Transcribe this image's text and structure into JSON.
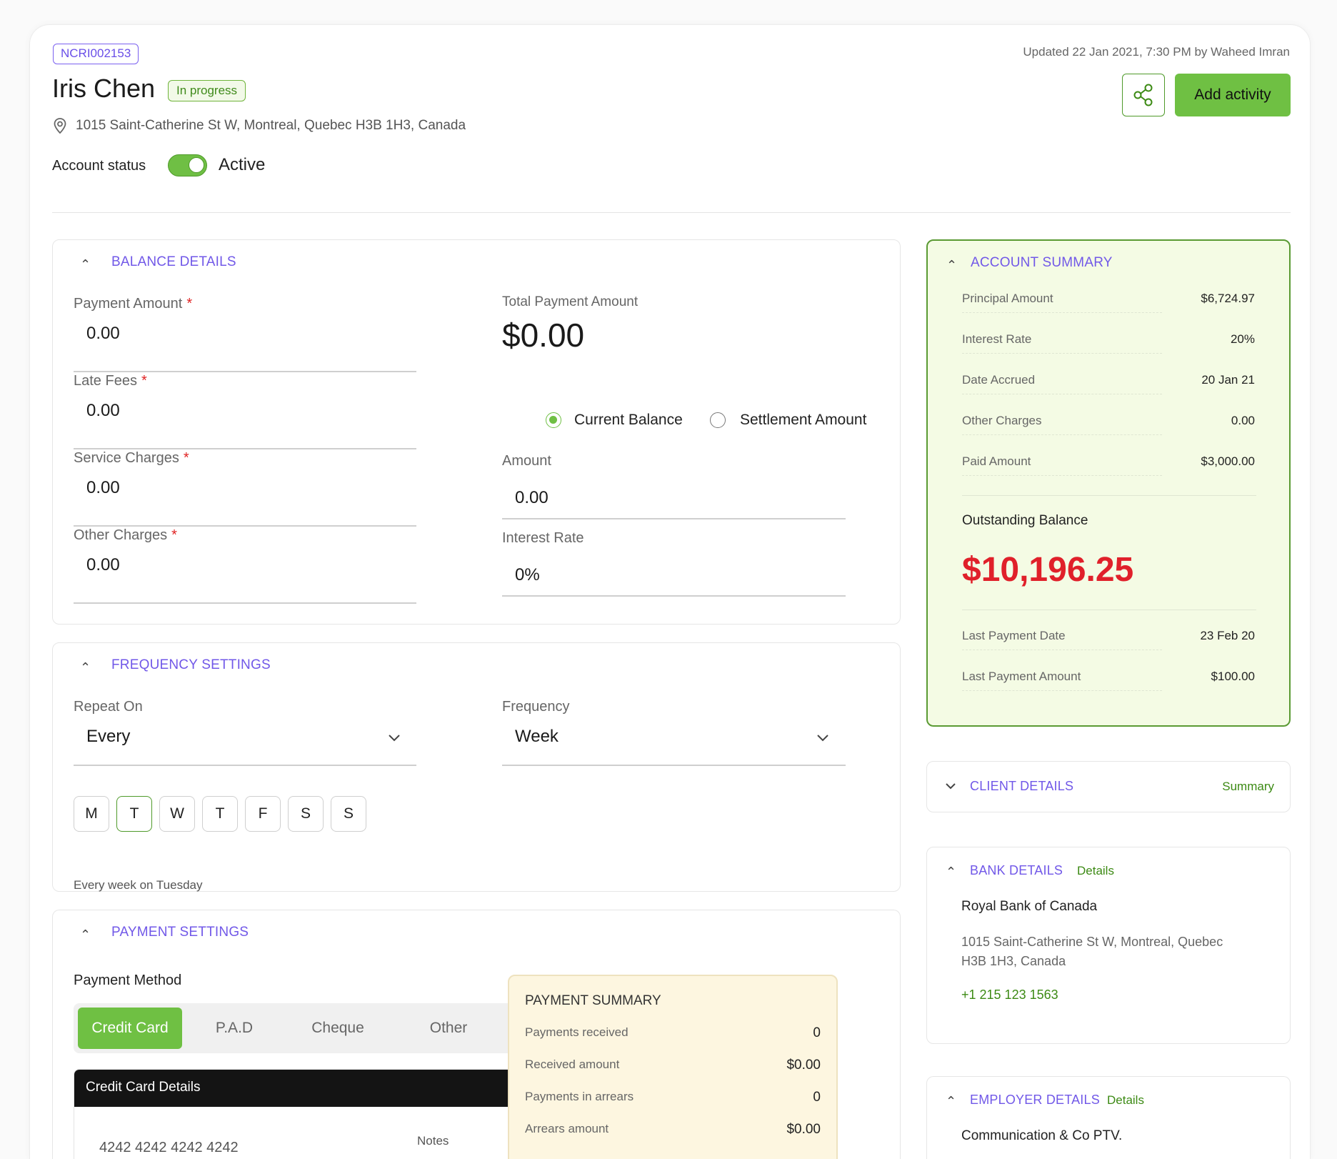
{
  "header": {
    "account_id": "NCRI002153",
    "name": "Iris Chen",
    "status": "In progress",
    "address": "1015 Saint-Catherine St W, Montreal, Quebec H3B 1H3, Canada",
    "account_status_label": "Account status",
    "account_status_value": "Active",
    "updated": "Updated 22 Jan 2021, 7:30 PM by Waheed Imran",
    "add_activity": "Add activity"
  },
  "balance": {
    "title": "BALANCE DETAILS",
    "fields": [
      {
        "label": "Payment Amount",
        "value": "0.00",
        "required": "*"
      },
      {
        "label": "Late Fees",
        "value": "0.00",
        "required": "*"
      },
      {
        "label": "Service Charges",
        "value": "0.00",
        "required": "*"
      },
      {
        "label": "Other Charges",
        "value": "0.00",
        "required": "*"
      }
    ],
    "total_label": "Total Payment Amount",
    "total_value": "$0.00",
    "radio_current": "Current Balance",
    "radio_settlement": "Settlement Amount",
    "amount_label": "Amount",
    "amount_value": "0.00",
    "interest_label": "Interest Rate",
    "interest_value": "0%"
  },
  "frequency": {
    "title": "FREQUENCY SETTINGS",
    "repeat_label": "Repeat On",
    "repeat_value": "Every",
    "freq_label": "Frequency",
    "freq_value": "Week",
    "days": [
      "M",
      "T",
      "W",
      "T",
      "F",
      "S",
      "S"
    ],
    "selected_day": "T",
    "note": "Every week on Tuesday"
  },
  "payment": {
    "title": "PAYMENT SETTINGS",
    "method_label": "Payment Method",
    "tabs": [
      "Credit Card",
      "P.A.D",
      "Cheque",
      "Other"
    ],
    "active_tab": "Credit Card",
    "card_header": "Credit Card Details",
    "card_number": "4242 4242 4242 4242",
    "notes_label": "Notes",
    "summary_title": "PAYMENT SUMMARY",
    "summary_rows": [
      {
        "label": "Payments received",
        "value": "0"
      },
      {
        "label": "Received amount",
        "value": "$0.00"
      },
      {
        "label": "Payments in arrears",
        "value": "0"
      },
      {
        "label": "Arrears amount",
        "value": "$0.00"
      }
    ]
  },
  "account_summary": {
    "title": "ACCOUNT SUMMARY",
    "rows": [
      {
        "label": "Principal Amount",
        "value": "$6,724.97"
      },
      {
        "label": "Interest Rate",
        "value": "20%"
      },
      {
        "label": "Date Accrued",
        "value": "20 Jan 21"
      },
      {
        "label": "Other Charges",
        "value": "0.00"
      },
      {
        "label": "Paid Amount",
        "value": "$3,000.00"
      }
    ],
    "outstanding_label": "Outstanding Balance",
    "outstanding_value": "$10,196.25",
    "last_rows": [
      {
        "label": "Last Payment Date",
        "value": "23 Feb 20"
      },
      {
        "label": "Last Payment Amount",
        "value": "$100.00"
      }
    ]
  },
  "client": {
    "title": "CLIENT DETAILS",
    "link": "Summary"
  },
  "bank": {
    "title": "BANK DETAILS",
    "link": "Details",
    "name": "Royal Bank of Canada",
    "address_line1": "1015 Saint-Catherine St W, Montreal, Quebec",
    "address_line2": "H3B 1H3, Canada",
    "phone": "+1 215 123 1563"
  },
  "employer": {
    "title": "EMPLOYER DETAILS",
    "link": "Details",
    "name": "Communication & Co PTV."
  },
  "colors": {
    "accent_purple": "#7158e8",
    "brand_green": "#6fc043",
    "outstanding_red": "#e0202a"
  }
}
